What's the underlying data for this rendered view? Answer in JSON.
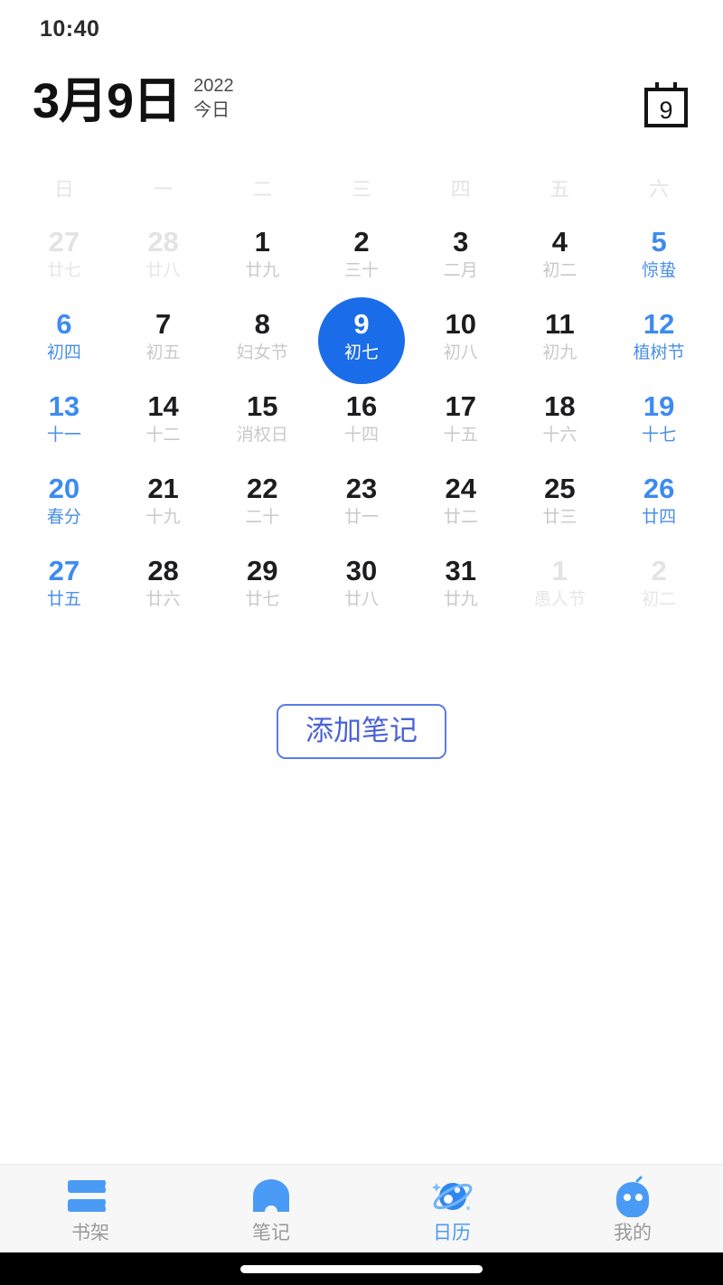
{
  "status_bar": {
    "time": "10:40"
  },
  "header": {
    "title": "3月9日",
    "year": "2022",
    "today_label": "今日",
    "calendar_icon_day": "9",
    "calendar_icon_name": "calendar-day-icon"
  },
  "calendar": {
    "weekdays": [
      "日",
      "一",
      "二",
      "三",
      "四",
      "五",
      "六"
    ],
    "accent_selected": "#1b6ce8",
    "accent_holiday": "#3d8bf2",
    "text_default": "#1d1d1f",
    "text_muted": "#c9c9cc",
    "text_outside": "#e3e3e5",
    "days": [
      {
        "num": "27",
        "lunar": "廿七",
        "state": "outside"
      },
      {
        "num": "28",
        "lunar": "廿八",
        "state": "outside"
      },
      {
        "num": "1",
        "lunar": "廿九",
        "state": "normal"
      },
      {
        "num": "2",
        "lunar": "三十",
        "state": "normal"
      },
      {
        "num": "3",
        "lunar": "二月",
        "state": "normal"
      },
      {
        "num": "4",
        "lunar": "初二",
        "state": "normal"
      },
      {
        "num": "5",
        "lunar": "惊蛰",
        "state": "holiday"
      },
      {
        "num": "6",
        "lunar": "初四",
        "state": "holiday"
      },
      {
        "num": "7",
        "lunar": "初五",
        "state": "normal"
      },
      {
        "num": "8",
        "lunar": "妇女节",
        "state": "normal"
      },
      {
        "num": "9",
        "lunar": "初七",
        "state": "selected"
      },
      {
        "num": "10",
        "lunar": "初八",
        "state": "normal"
      },
      {
        "num": "11",
        "lunar": "初九",
        "state": "normal"
      },
      {
        "num": "12",
        "lunar": "植树节",
        "state": "holiday"
      },
      {
        "num": "13",
        "lunar": "十一",
        "state": "holiday"
      },
      {
        "num": "14",
        "lunar": "十二",
        "state": "normal"
      },
      {
        "num": "15",
        "lunar": "消权日",
        "state": "normal"
      },
      {
        "num": "16",
        "lunar": "十四",
        "state": "normal"
      },
      {
        "num": "17",
        "lunar": "十五",
        "state": "normal"
      },
      {
        "num": "18",
        "lunar": "十六",
        "state": "normal"
      },
      {
        "num": "19",
        "lunar": "十七",
        "state": "holiday"
      },
      {
        "num": "20",
        "lunar": "春分",
        "state": "holiday"
      },
      {
        "num": "21",
        "lunar": "十九",
        "state": "normal"
      },
      {
        "num": "22",
        "lunar": "二十",
        "state": "normal"
      },
      {
        "num": "23",
        "lunar": "廿一",
        "state": "normal"
      },
      {
        "num": "24",
        "lunar": "廿二",
        "state": "normal"
      },
      {
        "num": "25",
        "lunar": "廿三",
        "state": "normal"
      },
      {
        "num": "26",
        "lunar": "廿四",
        "state": "holiday"
      },
      {
        "num": "27",
        "lunar": "廿五",
        "state": "holiday"
      },
      {
        "num": "28",
        "lunar": "廿六",
        "state": "normal"
      },
      {
        "num": "29",
        "lunar": "廿七",
        "state": "normal"
      },
      {
        "num": "30",
        "lunar": "廿八",
        "state": "normal"
      },
      {
        "num": "31",
        "lunar": "廿九",
        "state": "normal"
      },
      {
        "num": "1",
        "lunar": "愚人节",
        "state": "outside"
      },
      {
        "num": "2",
        "lunar": "初二",
        "state": "outside"
      }
    ]
  },
  "actions": {
    "add_note_label": "添加笔记"
  },
  "tab_bar": {
    "active_index": 2,
    "items": [
      {
        "label": "书架",
        "icon": "bookshelf-icon"
      },
      {
        "label": "笔记",
        "icon": "note-arch-icon"
      },
      {
        "label": "日历",
        "icon": "planet-calendar-icon"
      },
      {
        "label": "我的",
        "icon": "robot-head-icon"
      }
    ]
  }
}
